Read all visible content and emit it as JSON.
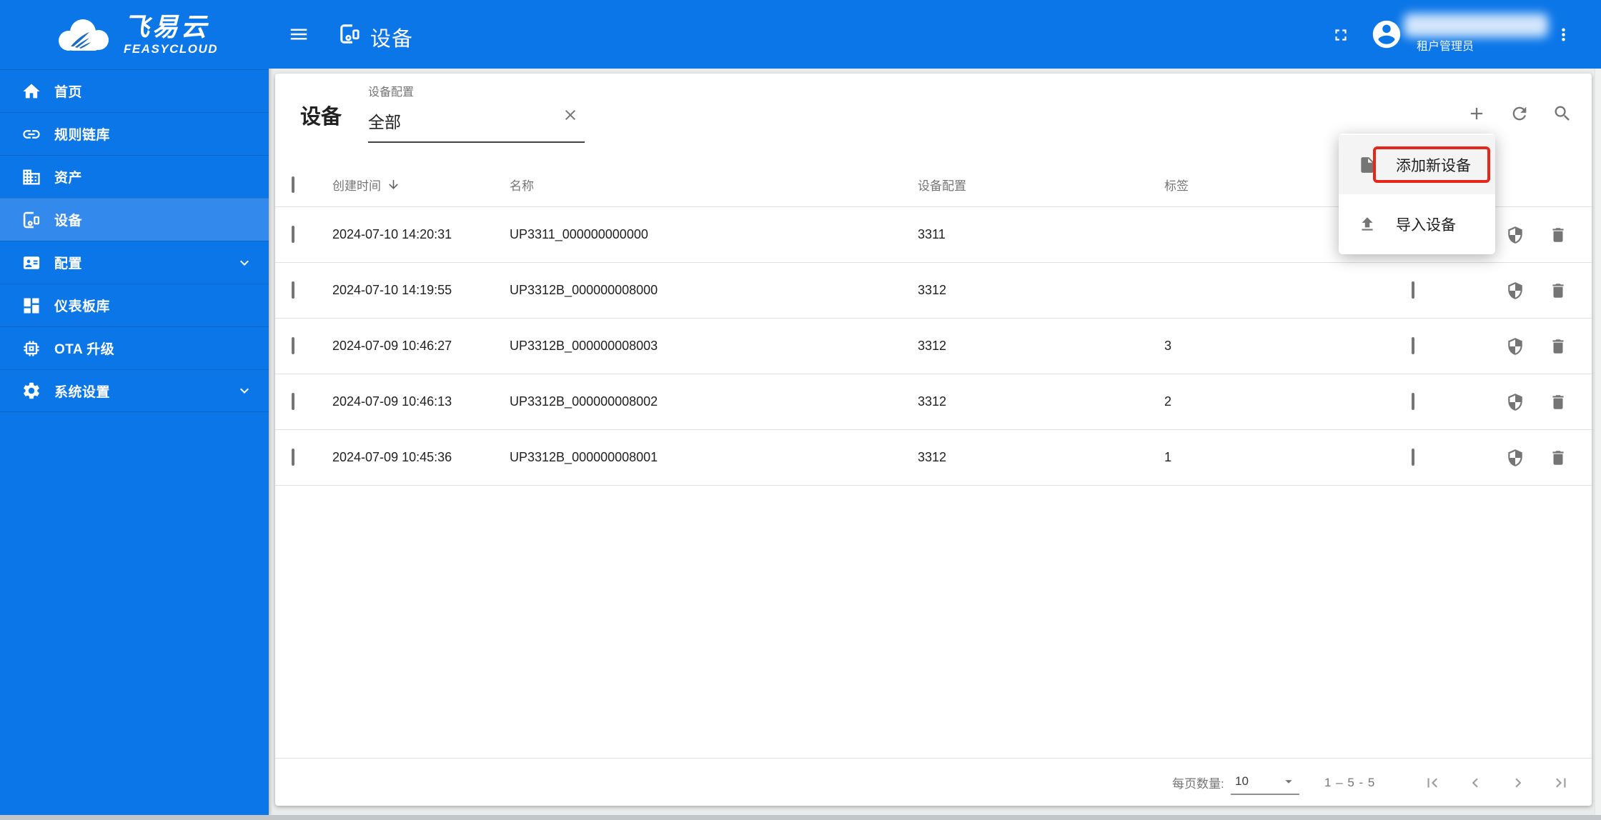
{
  "app": {
    "brand_cn": "飞易云",
    "brand_en": "FEASYCLOUD"
  },
  "topbar": {
    "title": "设备",
    "user_role": "租户管理员"
  },
  "sidebar": {
    "items": [
      {
        "label": "首页",
        "icon": "home",
        "active": false
      },
      {
        "label": "规则链库",
        "icon": "link",
        "active": false
      },
      {
        "label": "资产",
        "icon": "building",
        "active": false
      },
      {
        "label": "设备",
        "icon": "devices",
        "active": true
      },
      {
        "label": "配置",
        "icon": "id-badge",
        "active": false,
        "expandable": true
      },
      {
        "label": "仪表板库",
        "icon": "dashboard",
        "active": false
      },
      {
        "label": "OTA 升级",
        "icon": "chip",
        "active": false
      },
      {
        "label": "系统设置",
        "icon": "gear",
        "active": false,
        "expandable": true
      }
    ]
  },
  "content": {
    "page_title": "设备",
    "filter": {
      "label": "设备配置",
      "value": "全部"
    },
    "table": {
      "headers": {
        "created": "创建时间",
        "name": "名称",
        "profile": "设备配置",
        "tag": "标签"
      },
      "rows": [
        {
          "created": "2024-07-10 14:20:31",
          "name": "UP3311_000000000000",
          "profile": "3311",
          "tag": "",
          "checked": false
        },
        {
          "created": "2024-07-10 14:19:55",
          "name": "UP3312B_000000008000",
          "profile": "3312",
          "tag": "",
          "checked": true
        },
        {
          "created": "2024-07-09 10:46:27",
          "name": "UP3312B_000000008003",
          "profile": "3312",
          "tag": "3",
          "checked": false
        },
        {
          "created": "2024-07-09 10:46:13",
          "name": "UP3312B_000000008002",
          "profile": "3312",
          "tag": "2",
          "checked": false
        },
        {
          "created": "2024-07-09 10:45:36",
          "name": "UP3312B_000000008001",
          "profile": "3312",
          "tag": "1",
          "checked": false
        }
      ]
    },
    "menu": {
      "items": [
        {
          "label": "添加新设备",
          "icon": "file",
          "highlighted": true
        },
        {
          "label": "导入设备",
          "icon": "upload",
          "highlighted": false
        }
      ]
    },
    "pagination": {
      "per_page_label": "每页数量:",
      "per_page_value": "10",
      "range": "1 – 5 - 5"
    }
  },
  "colors": {
    "primary": "#0b76e8",
    "primary_active": "#3389ec",
    "annotation_red": "#e5261b",
    "icon_gray": "#757575"
  }
}
